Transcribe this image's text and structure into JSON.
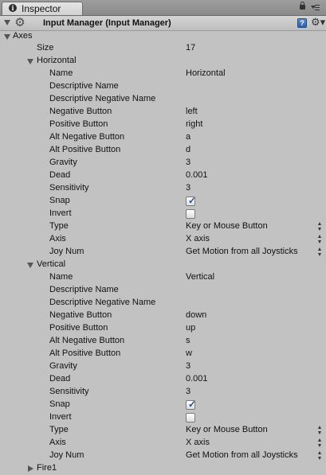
{
  "tab": {
    "label": "Inspector",
    "icon": "info-icon"
  },
  "header": {
    "title": "Input Manager (Input Manager)"
  },
  "axes": {
    "label": "Axes",
    "size_label": "Size",
    "size_value": "17",
    "groups": [
      {
        "name": "Horizontal",
        "expanded": true,
        "fields": {
          "name_label": "Name",
          "name_value": "Horizontal",
          "desc_label": "Descriptive Name",
          "desc_value": "",
          "desc_neg_label": "Descriptive Negative Name",
          "desc_neg_value": "",
          "neg_btn_label": "Negative Button",
          "neg_btn_value": "left",
          "pos_btn_label": "Positive Button",
          "pos_btn_value": "right",
          "alt_neg_label": "Alt Negative Button",
          "alt_neg_value": "a",
          "alt_pos_label": "Alt Positive Button",
          "alt_pos_value": "d",
          "gravity_label": "Gravity",
          "gravity_value": "3",
          "dead_label": "Dead",
          "dead_value": "0.001",
          "sens_label": "Sensitivity",
          "sens_value": "3",
          "snap_label": "Snap",
          "snap_checked": true,
          "invert_label": "Invert",
          "invert_checked": false,
          "type_label": "Type",
          "type_value": "Key or Mouse Button",
          "axis_label": "Axis",
          "axis_value": "X axis",
          "joy_label": "Joy Num",
          "joy_value": "Get Motion from all Joysticks"
        }
      },
      {
        "name": "Vertical",
        "expanded": true,
        "fields": {
          "name_label": "Name",
          "name_value": "Vertical",
          "desc_label": "Descriptive Name",
          "desc_value": "",
          "desc_neg_label": "Descriptive Negative Name",
          "desc_neg_value": "",
          "neg_btn_label": "Negative Button",
          "neg_btn_value": "down",
          "pos_btn_label": "Positive Button",
          "pos_btn_value": "up",
          "alt_neg_label": "Alt Negative Button",
          "alt_neg_value": "s",
          "alt_pos_label": "Alt Positive Button",
          "alt_pos_value": "w",
          "gravity_label": "Gravity",
          "gravity_value": "3",
          "dead_label": "Dead",
          "dead_value": "0.001",
          "sens_label": "Sensitivity",
          "sens_value": "3",
          "snap_label": "Snap",
          "snap_checked": true,
          "invert_label": "Invert",
          "invert_checked": false,
          "type_label": "Type",
          "type_value": "Key or Mouse Button",
          "axis_label": "Axis",
          "axis_value": "X axis",
          "joy_label": "Joy Num",
          "joy_value": "Get Motion from all Joysticks"
        }
      },
      {
        "name": "Fire1",
        "expanded": false
      }
    ]
  }
}
